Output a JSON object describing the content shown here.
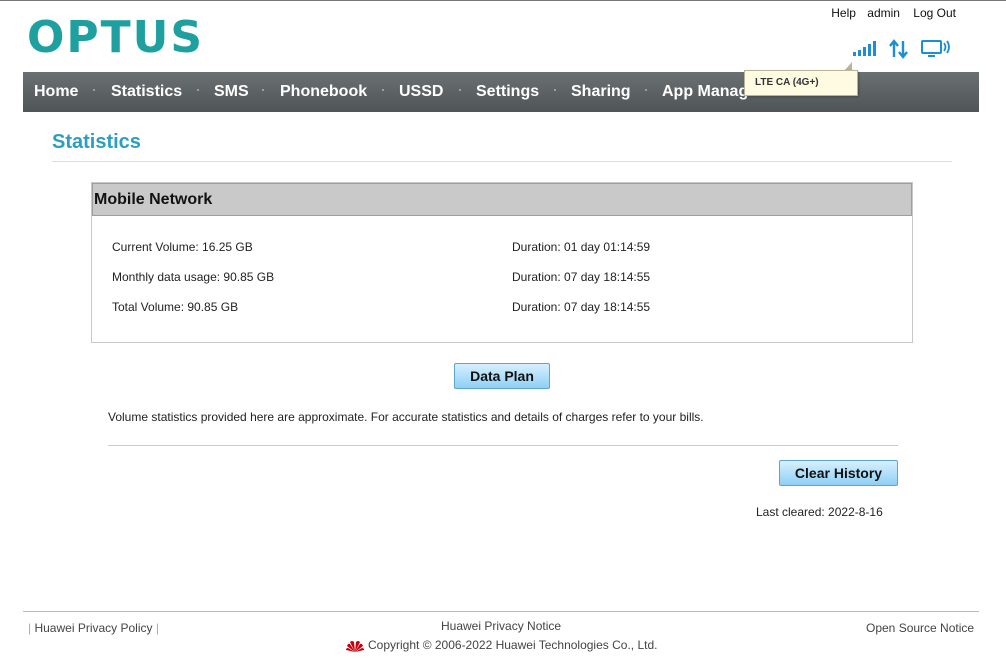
{
  "header": {
    "logo_text": "OPTUS",
    "links": {
      "help": "Help",
      "user": "admin",
      "logout": "Log Out"
    },
    "status_icons": [
      "signal-icon",
      "data-transfer-icon",
      "connected-device-icon"
    ],
    "signal_tooltip": "LTE CA (4G+)"
  },
  "nav": {
    "items": [
      "Home",
      "Statistics",
      "SMS",
      "Phonebook",
      "USSD",
      "Settings",
      "Sharing",
      "App Manag"
    ]
  },
  "page": {
    "title": "Statistics"
  },
  "mobile_network": {
    "title": "Mobile Network",
    "current_volume": "Current Volume: 16.25 GB",
    "current_duration": "Duration: 01 day 01:14:59",
    "monthly_usage": "Monthly data usage: 90.85 GB",
    "monthly_duration": "Duration: 07 day 18:14:55",
    "total_volume": "Total Volume: 90.85 GB",
    "total_duration": "Duration: 07 day 18:14:55"
  },
  "actions": {
    "data_plan": "Data Plan",
    "clear_history": "Clear History"
  },
  "note": "Volume statistics provided here are approximate. For accurate statistics and details of charges refer to your bills.",
  "last_cleared": "Last cleared: 2022-8-16",
  "footer": {
    "privacy_policy": "Huawei Privacy Policy",
    "privacy_notice": "Huawei Privacy Notice",
    "open_source": "Open Source Notice",
    "copyright": "Copyright © 2006-2022 Huawei Technologies Co., Ltd."
  },
  "colors": {
    "brand": "#1fa0a0",
    "title": "#2c9fc0",
    "icon_blue": "#1b8fd6",
    "nav_bg": "#5a6061",
    "button": "#8fd0f4"
  }
}
